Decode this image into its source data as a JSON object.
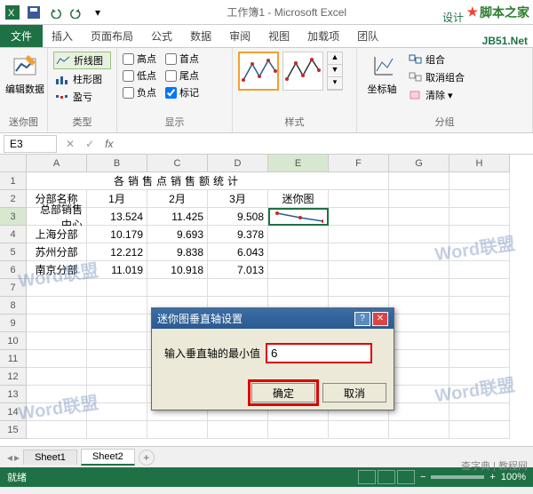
{
  "app": {
    "title": "工作簿1 - Microsoft Excel",
    "brand_top": "脚本之家",
    "brand_sub": "JB51.Net"
  },
  "qat": {
    "save": "保存",
    "undo": "撤消",
    "redo": "恢复"
  },
  "tabs": {
    "file": "文件",
    "items": [
      "插入",
      "页面布局",
      "公式",
      "数据",
      "审阅",
      "视图",
      "加载项",
      "团队"
    ],
    "context": "设计"
  },
  "ribbon": {
    "g1": {
      "label": "迷你图",
      "edit": "编辑数据"
    },
    "g2": {
      "label": "类型",
      "line": "折线图",
      "column": "柱形图",
      "winloss": "盈亏"
    },
    "g3": {
      "label": "显示",
      "hp": "高点",
      "lp": "低点",
      "np": "负点",
      "fp": "首点",
      "ep": "尾点",
      "mk": "标记"
    },
    "g4": {
      "label": "样式"
    },
    "g5": {
      "label": "分组",
      "axis": "坐标轴",
      "group": "组合",
      "ungroup": "取消组合",
      "clear": "清除"
    }
  },
  "formula": {
    "cell": "E3",
    "fx": "fx"
  },
  "cols": [
    "A",
    "B",
    "C",
    "D",
    "E",
    "F",
    "G",
    "H"
  ],
  "rows": [
    "1",
    "2",
    "3",
    "4",
    "5",
    "6",
    "7",
    "8",
    "9",
    "10",
    "11",
    "12",
    "13",
    "14",
    "15"
  ],
  "data": {
    "title": "各销售点销售额统计",
    "headers": [
      "分部名称",
      "1月",
      "2月",
      "3月",
      "迷你图"
    ],
    "body": [
      [
        "总部销售中心",
        "13.524",
        "11.425",
        "9.508"
      ],
      [
        "上海分部",
        "10.179",
        "9.693",
        "9.378"
      ],
      [
        "苏州分部",
        "12.212",
        "9.838",
        "6.043"
      ],
      [
        "南京分部",
        "11.019",
        "10.918",
        "7.013"
      ]
    ]
  },
  "chart_data": {
    "type": "line",
    "title": "迷你图 (sparkline in E3)",
    "categories": [
      "1月",
      "2月",
      "3月"
    ],
    "values": [
      13.524,
      11.425,
      9.508
    ],
    "ylim": [
      6,
      14
    ]
  },
  "dialog": {
    "title": "迷你图垂直轴设置",
    "label": "输入垂直轴的最小值",
    "value": "6",
    "ok": "确定",
    "cancel": "取消"
  },
  "sheets": {
    "s1": "Sheet1",
    "s2": "Sheet2"
  },
  "status": {
    "ready": "就绪",
    "zoom": "100%"
  },
  "watermark": "Word联盟",
  "footer": "查字典 | 教程网"
}
